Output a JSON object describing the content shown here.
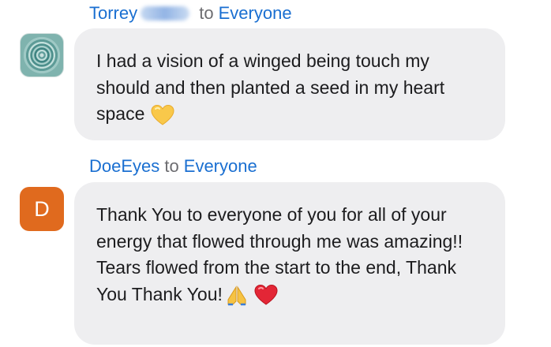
{
  "chat": {
    "messages": [
      {
        "sender": "Torrey",
        "to_word": "to",
        "recipient": "Everyone",
        "avatar_icon": "mandala-avatar-icon",
        "text": "I had a vision of a winged being touch my should and then planted a seed in my heart space",
        "emojis": [
          "yellow-heart-emoji"
        ]
      },
      {
        "sender": "DoeEyes",
        "to_word": "to",
        "recipient": "Everyone",
        "avatar_letter": "D",
        "text": "Thank You to everyone of you for all of your energy that flowed through me was amazing!! Tears flowed from the start to the end, Thank You Thank You!",
        "emojis": [
          "folded-hands-emoji",
          "red-heart-emoji"
        ]
      }
    ]
  },
  "colors": {
    "link_blue": "#1a6fd1",
    "bubble_gray": "#eeeef0",
    "avatar_orange": "#e06a1e",
    "yellow_heart": "#f9c84a",
    "red_heart": "#e32636"
  }
}
